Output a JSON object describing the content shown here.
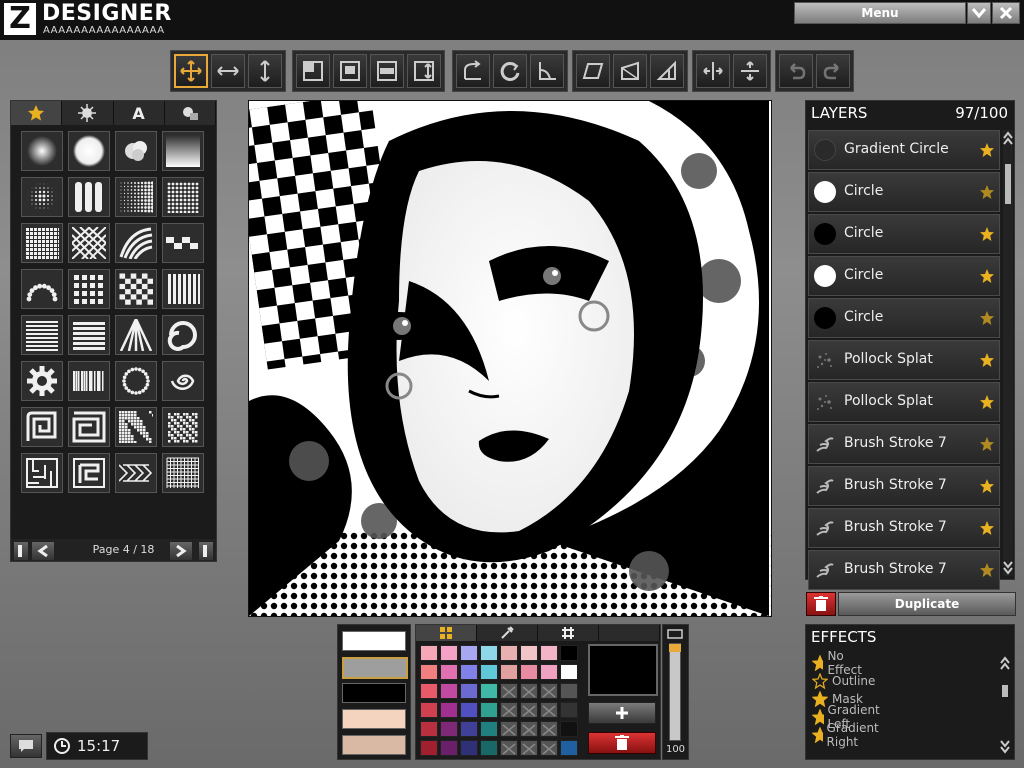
{
  "app": {
    "logo_glyph": "Z",
    "name": "DESIGNER",
    "subtitle": "AAAAAAAAAAAAAAAA"
  },
  "menu": {
    "label": "Menu"
  },
  "toolbar": {
    "groups": [
      [
        "move-icon",
        "scale-horizontal-icon",
        "scale-vertical-icon"
      ],
      [
        "align-top-left-icon",
        "align-center-icon",
        "distribute-vertical-icon",
        "distribute-horizontal-icon"
      ],
      [
        "rotate-right-icon",
        "rotate-reset-icon",
        "rotate-left-icon"
      ],
      [
        "skew-icon",
        "skew-vertical-icon",
        "perspective-icon"
      ],
      [
        "flip-horizontal-icon",
        "flip-vertical-icon"
      ],
      [
        "undo-icon",
        "redo-icon"
      ]
    ]
  },
  "shapes": {
    "tabs": [
      "star-tab-icon",
      "splat-tab-icon",
      "text-tab-icon",
      "symbols-tab-icon"
    ],
    "text_tab_label": "A",
    "page_label": "Page 4 / 18"
  },
  "layers": {
    "title": "LAYERS",
    "count": "97/100",
    "items": [
      {
        "name": "Gradient Circle",
        "thumb": "dark"
      },
      {
        "name": "Circle",
        "thumb": "white"
      },
      {
        "name": "Circle",
        "thumb": "black"
      },
      {
        "name": "Circle",
        "thumb": "white"
      },
      {
        "name": "Circle",
        "thumb": "black"
      },
      {
        "name": "Pollock Splat",
        "thumb": "splat"
      },
      {
        "name": "Pollock Splat",
        "thumb": "splat"
      },
      {
        "name": "Brush Stroke 7",
        "thumb": "brush"
      },
      {
        "name": "Brush Stroke 7",
        "thumb": "brush"
      },
      {
        "name": "Brush Stroke 7",
        "thumb": "brush"
      },
      {
        "name": "Brush Stroke 7",
        "thumb": "brush"
      }
    ],
    "duplicate_label": "Duplicate"
  },
  "effects": {
    "title": "EFFECTS",
    "items": [
      "No Effect",
      "Outline",
      "Mask",
      "Gradient Left",
      "Gradient Right"
    ]
  },
  "colors": {
    "swatches": [
      "#ffffff",
      "#9e9e9e",
      "#000000",
      "#f4d4bf",
      "#d9b9a3"
    ],
    "palette": [
      "#f7a8b8",
      "#f4a3c6",
      "#a8a8f2",
      "#8fd8ea",
      "#e8b0b0",
      "#f1c4c8",
      "#f4b4c8",
      "#000000",
      "#f08080",
      "#e070b0",
      "#8080e8",
      "#60c8d8",
      "#e0a0a0",
      "#e88aa0",
      "#f0a0c0",
      "#ffffff",
      "#e85a6a",
      "#c04aa0",
      "#6a6ad0",
      "#40b8a8",
      "x",
      "x",
      "x",
      "#555555",
      "#d04050",
      "#a03090",
      "#5050c0",
      "#30a090",
      "x",
      "x",
      "x",
      "#333333",
      "#b83040",
      "#802878",
      "#404098",
      "#208080",
      "x",
      "x",
      "x",
      "#111111",
      "#a02030",
      "#6a2068",
      "#303078",
      "#186868",
      "x",
      "x",
      "x",
      "#2060a0"
    ],
    "opacity_value": "100"
  },
  "status": {
    "time": "15:17"
  },
  "accent": "#e9a93a"
}
